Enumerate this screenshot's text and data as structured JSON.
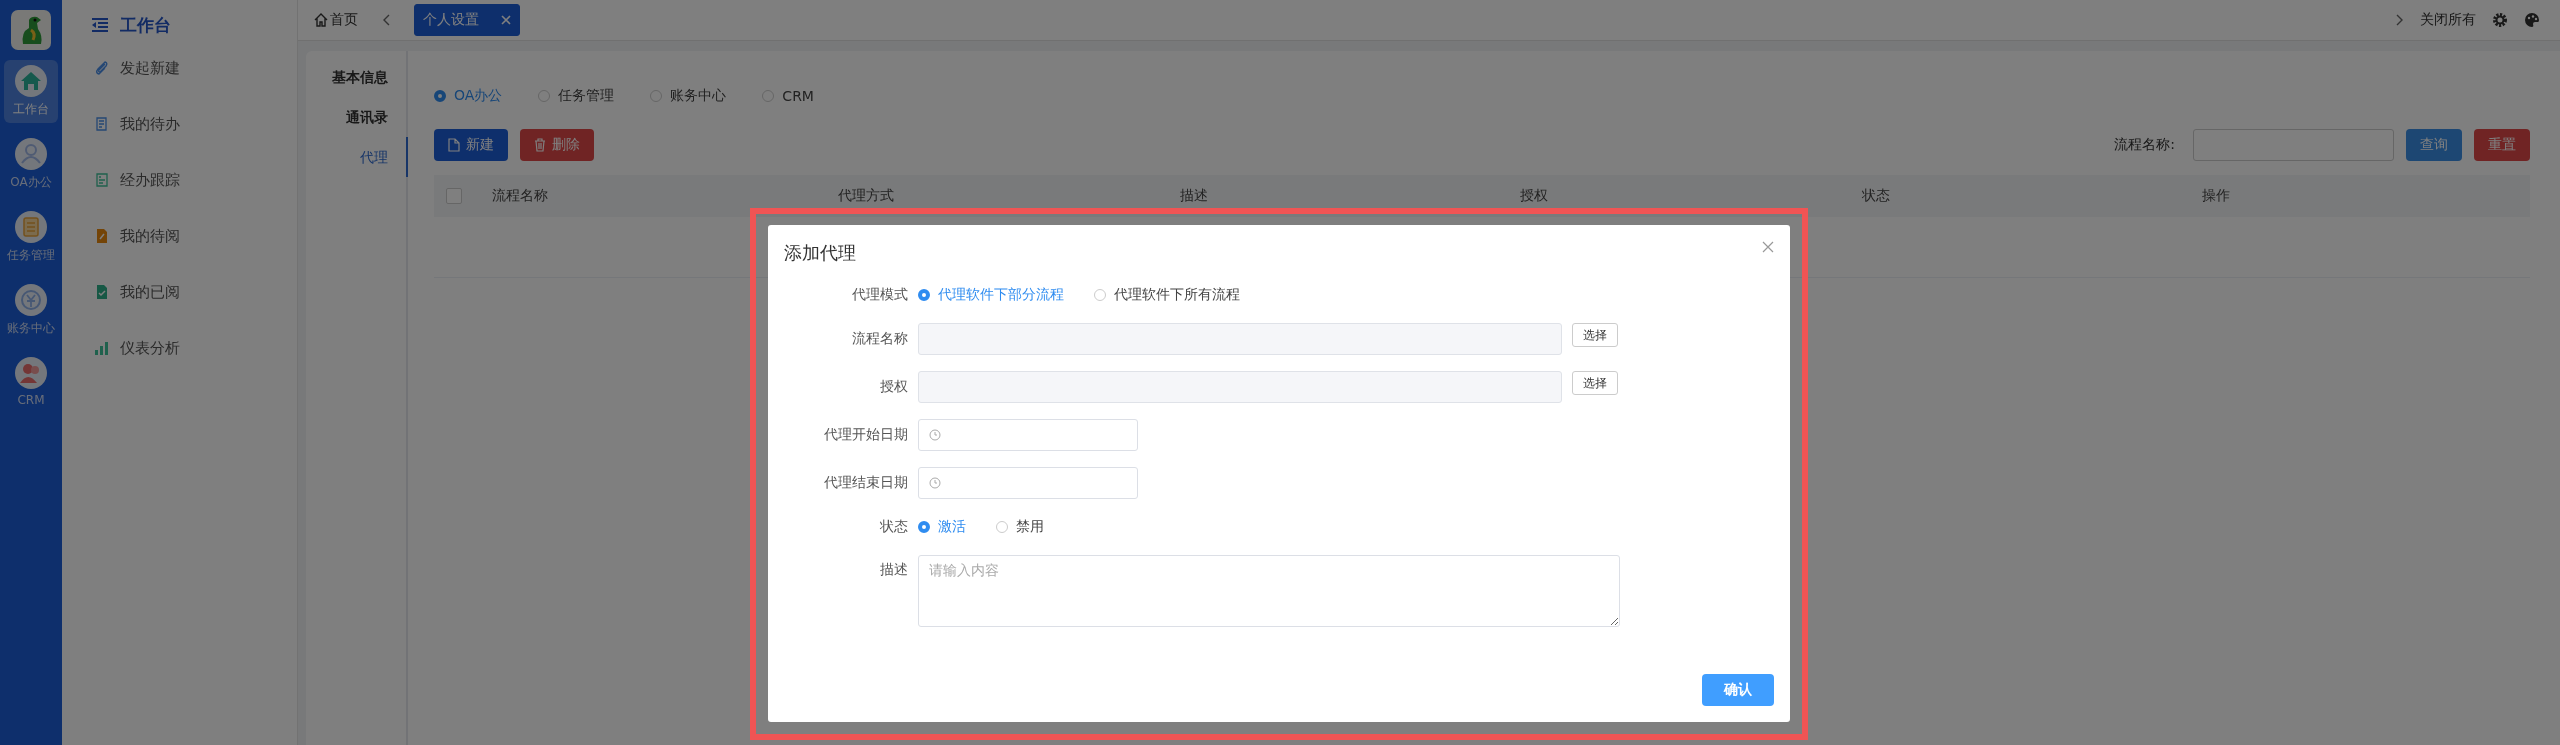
{
  "app_nav": [
    {
      "label": "工作台",
      "kind": "home",
      "selected": true
    },
    {
      "label": "OA办公",
      "kind": "people",
      "selected": false
    },
    {
      "label": "任务管理",
      "kind": "tasks",
      "selected": false
    },
    {
      "label": "账务中心",
      "kind": "money",
      "selected": false
    },
    {
      "label": "CRM",
      "kind": "crm",
      "selected": false
    }
  ],
  "side_menu": {
    "title": "工作台",
    "items": [
      {
        "label": "发起新建",
        "kind": "clip"
      },
      {
        "label": "我的待办",
        "kind": "doc"
      },
      {
        "label": "经办跟踪",
        "kind": "track"
      },
      {
        "label": "我的待阅",
        "kind": "edit"
      },
      {
        "label": "我的已阅",
        "kind": "done"
      },
      {
        "label": "仪表分析",
        "kind": "chart"
      }
    ]
  },
  "top_bar": {
    "home": "首页",
    "tabs": [
      {
        "label": "个人设置",
        "selected": true
      }
    ],
    "close_all": "关闭所有"
  },
  "settings_tabs": [
    {
      "label": "基本信息",
      "selected": false
    },
    {
      "label": "通讯录",
      "selected": false
    },
    {
      "label": "代理",
      "selected": true
    }
  ],
  "module_radios": [
    {
      "label": "OA办公",
      "selected": true
    },
    {
      "label": "任务管理",
      "selected": false
    },
    {
      "label": "账务中心",
      "selected": false
    },
    {
      "label": "CRM",
      "selected": false
    }
  ],
  "actions": [
    {
      "label": "新建",
      "kind": "create"
    },
    {
      "label": "删除",
      "kind": "delete"
    }
  ],
  "search": {
    "label": "流程名称:",
    "query_button": "查询",
    "reset_button": "重置"
  },
  "table": {
    "select_all_checked": false,
    "columns": [
      "流程名称",
      "代理方式",
      "描述",
      "授权",
      "状态",
      "操作"
    ]
  },
  "dialog": {
    "title": "添加代理",
    "fields": [
      {
        "kind": "radio",
        "label": "代理模式",
        "options": [
          {
            "label": "代理软件下部分流程",
            "selected": true
          },
          {
            "label": "代理软件下所有流程",
            "selected": false
          }
        ]
      },
      {
        "kind": "picker",
        "label": "流程名称",
        "button": "选择"
      },
      {
        "kind": "picker",
        "label": "授权",
        "button": "选择"
      },
      {
        "kind": "date",
        "label": "代理开始日期"
      },
      {
        "kind": "date",
        "label": "代理结束日期"
      },
      {
        "kind": "radio",
        "label": "状态",
        "options": [
          {
            "label": "激活",
            "selected": true
          },
          {
            "label": "禁用",
            "selected": false
          }
        ]
      },
      {
        "kind": "textarea",
        "label": "描述",
        "placeholder": "请输入内容"
      }
    ],
    "confirm": "确认"
  }
}
